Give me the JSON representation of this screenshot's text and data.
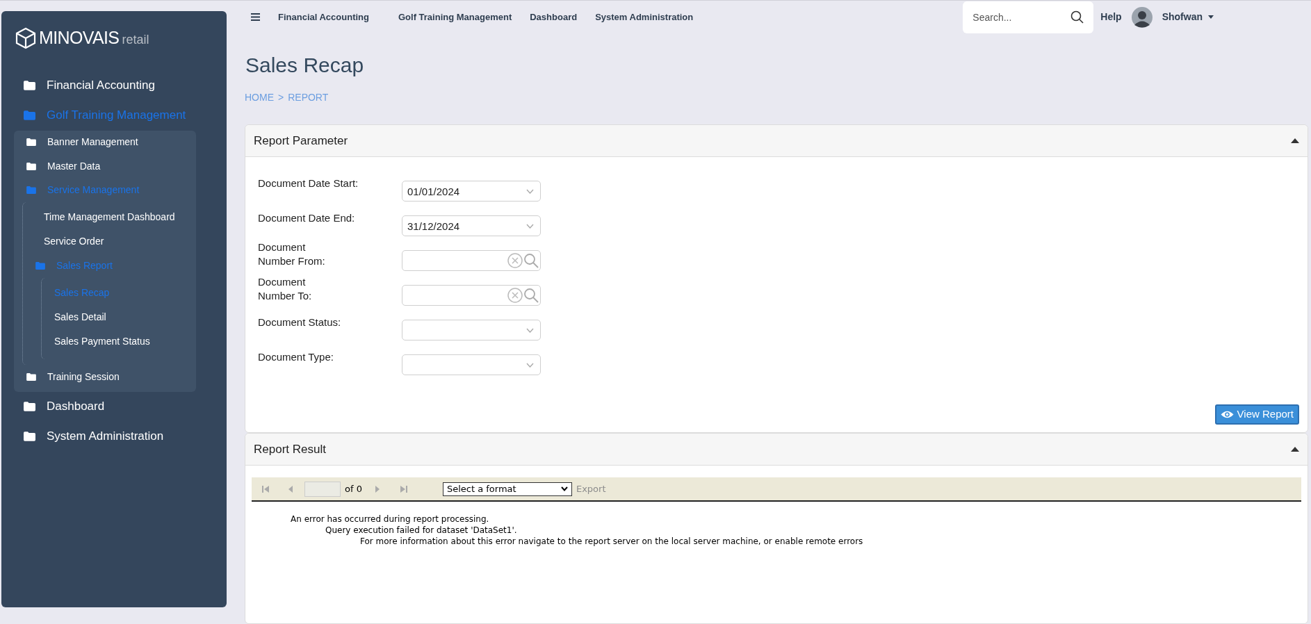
{
  "sidebar": {
    "logo": {
      "brand": "MINOVAIS",
      "suffix": "retail"
    },
    "items": [
      {
        "label": "Financial Accounting",
        "kind": "folder",
        "active": false
      },
      {
        "label": "Golf Training Management",
        "kind": "folder",
        "active": true,
        "expanded": true,
        "children": [
          {
            "label": "Banner Management",
            "kind": "folder",
            "active": false
          },
          {
            "label": "Master Data",
            "kind": "folder",
            "active": false
          },
          {
            "label": "Service Management",
            "kind": "folder",
            "active": true,
            "expanded": true,
            "children": [
              {
                "label": "Time Management Dashboard",
                "kind": "page",
                "active": false
              },
              {
                "label": "Service Order",
                "kind": "page",
                "active": false
              },
              {
                "label": "Sales Report",
                "kind": "folder",
                "active": true,
                "expanded": true,
                "children": [
                  {
                    "label": "Sales Recap",
                    "kind": "page",
                    "active": true
                  },
                  {
                    "label": "Sales Detail",
                    "kind": "page",
                    "active": false
                  },
                  {
                    "label": "Sales Payment Status",
                    "kind": "page",
                    "active": false
                  }
                ]
              }
            ]
          },
          {
            "label": "Training Session",
            "kind": "folder",
            "active": false
          }
        ]
      },
      {
        "label": "Dashboard",
        "kind": "folder",
        "active": false
      },
      {
        "label": "System Administration",
        "kind": "folder",
        "active": false
      }
    ]
  },
  "topbar": {
    "menu": [
      "Financial Accounting",
      "Golf Training Management",
      "Dashboard",
      "System Administration"
    ],
    "search": {
      "placeholder": "Search..."
    },
    "help": "Help",
    "user": "Shofwan"
  },
  "page": {
    "title": "Sales Recap",
    "breadcrumb": [
      "HOME",
      ">",
      "REPORT"
    ]
  },
  "report_parameter": {
    "title": "Report Parameter",
    "expanded": true,
    "fields": [
      {
        "label": "Document Date Start:",
        "kind": "date",
        "value": "01/01/2024"
      },
      {
        "label": "Document Date End:",
        "kind": "date",
        "value": "31/12/2024"
      },
      {
        "label": "Document\nNumber From:",
        "kind": "lookup"
      },
      {
        "label": "Document\nNumber To:",
        "kind": "lookup"
      },
      {
        "label": "Document Status:",
        "kind": "select"
      },
      {
        "label": "Document Type:",
        "kind": "select"
      }
    ],
    "button": "View Report"
  },
  "report_result": {
    "title": "Report Result",
    "expanded": true,
    "toolbar": {
      "page_of": "of 0",
      "format": "Select a format",
      "export": "Export"
    },
    "error_lines": [
      "An error has occurred during report processing.",
      "Query execution failed for dataset 'DataSet1'.",
      "For more information about this error navigate to the report server on the local server machine, or enable remote errors"
    ]
  }
}
